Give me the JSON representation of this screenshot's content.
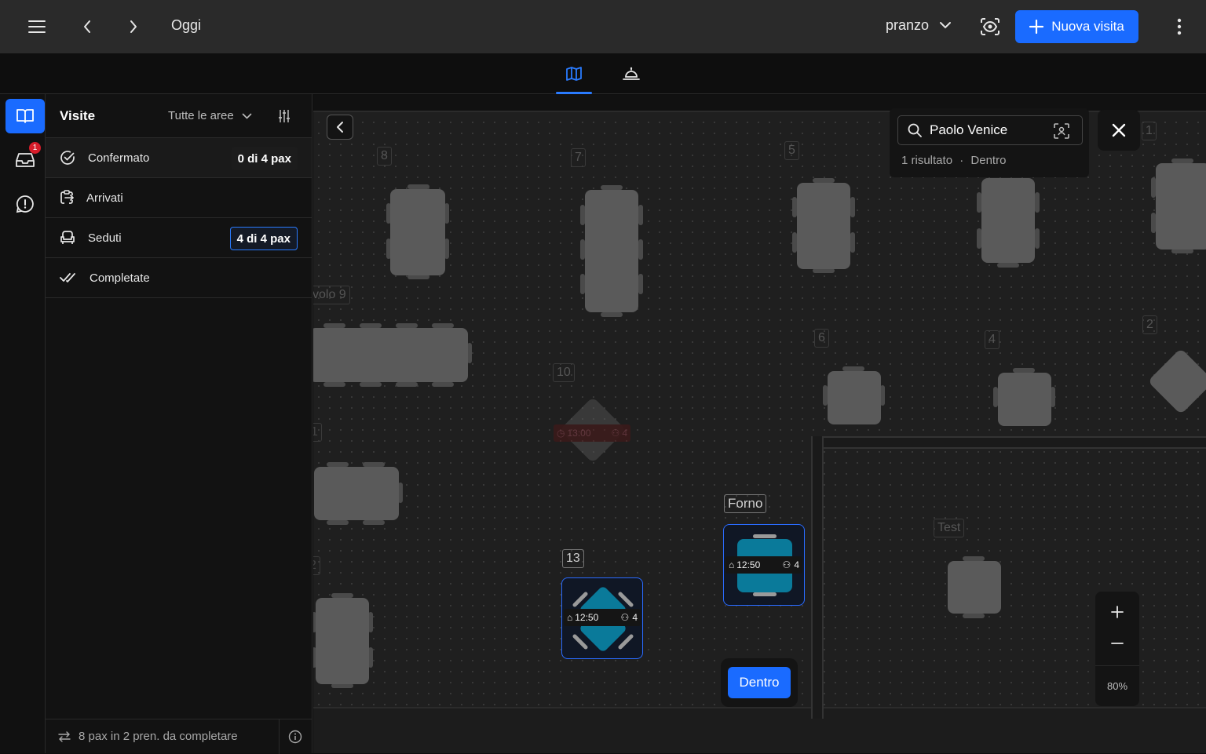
{
  "topbar": {
    "date_label": "Oggi",
    "service_label": "pranzo",
    "new_visit_label": "Nuova visita"
  },
  "tabs": [
    {
      "icon": "map-icon",
      "active": true
    },
    {
      "icon": "service-bell-icon",
      "active": false
    }
  ],
  "rail": {
    "items": [
      {
        "icon": "book-open-icon",
        "active": true
      },
      {
        "icon": "inbox-icon",
        "badge": "1"
      },
      {
        "icon": "alert-circle-icon"
      }
    ]
  },
  "panel": {
    "title": "Visite",
    "area_filter": "Tutte le aree",
    "rows": [
      {
        "label": "Confermato",
        "count": "0 di 4 pax",
        "icon": "check-circle-icon",
        "selected": true
      },
      {
        "label": "Arrivati",
        "count": "",
        "icon": "clipboard-arrow-icon"
      },
      {
        "label": "Seduti",
        "count": "4 di 4 pax",
        "icon": "armchair-icon",
        "highlight": true
      },
      {
        "label": "Completate",
        "count": "",
        "icon": "double-check-icon"
      }
    ],
    "footer_text": "8 pax in 2 pren. da completare"
  },
  "map": {
    "search": {
      "value": "Paolo Venice",
      "result_count": "1 risultato",
      "result_status": "Dentro"
    },
    "zoom_level": "80%",
    "dentro_button": "Dentro",
    "labels": {
      "t8": "8",
      "t7": "7",
      "t5": "5",
      "t1": "1",
      "t9": "volo 9",
      "t10": "10",
      "t6": "6",
      "t4": "4",
      "t2": "2",
      "t13": "13",
      "forno": "Forno",
      "test": "Test",
      "partial1": "1",
      "partial2": "2"
    },
    "reservations": {
      "t10": {
        "time": "13:00",
        "pax": "4"
      },
      "t13": {
        "time": "12:50",
        "pax": "4"
      },
      "forno": {
        "time": "12:50",
        "pax": "4"
      }
    },
    "colors": {
      "accent": "#1a6bff",
      "seated_table": "#0a7a9a",
      "late_chip": "#5a1414"
    }
  }
}
